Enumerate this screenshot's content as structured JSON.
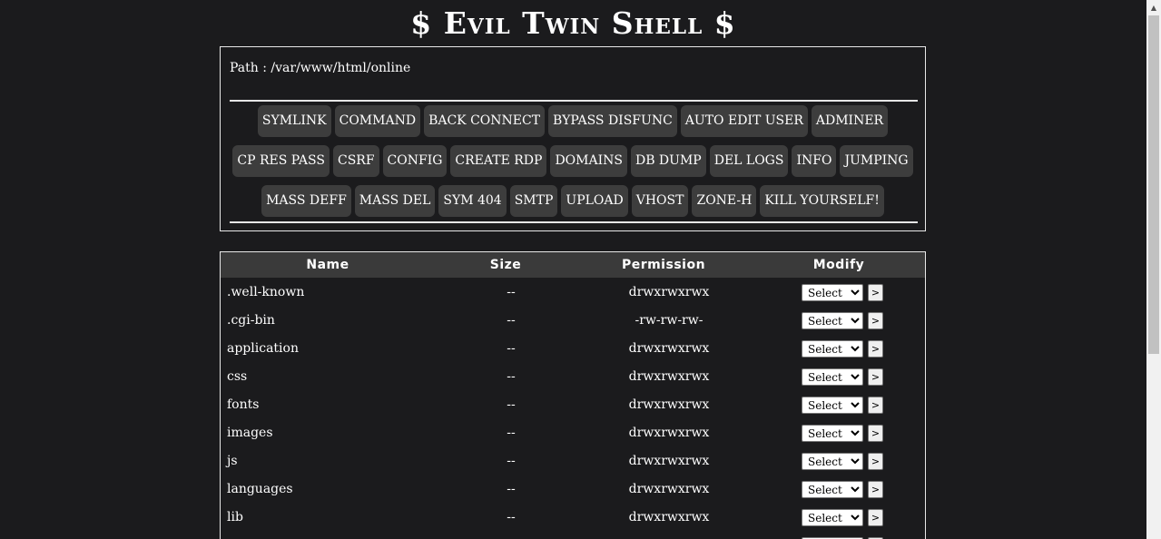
{
  "site": {
    "title": "$ Evil Twin Shell $"
  },
  "path": {
    "label": "Path :",
    "segments": [
      "/",
      "var",
      "/",
      "www",
      "/",
      "html",
      "/",
      "online"
    ]
  },
  "menu": {
    "rows": [
      [
        "SYMLINK",
        "COMMAND",
        "BACK CONNECT",
        "BYPASS DISFUNC",
        "AUTO EDIT USER",
        "ADMINER"
      ],
      [
        "CP RES PASS",
        "CSRF",
        "CONFIG",
        "CREATE RDP",
        "DOMAINS",
        "DB DUMP",
        "DEL LOGS",
        "INFO",
        "JUMPING"
      ],
      [
        "MASS DEFF",
        "MASS DEL",
        "SYM 404",
        "SMTP",
        "UPLOAD",
        "VHOST",
        "ZONE-H",
        "KILL YOURSELF!"
      ]
    ]
  },
  "table": {
    "headers": [
      "Name",
      "Size",
      "Permission",
      "Modify"
    ],
    "select_placeholder": "Select",
    "go_label": ">",
    "rows": [
      {
        "name": ".well-known",
        "size": "--",
        "perm": "drwxrwxrwx"
      },
      {
        "name": ".cgi-bin",
        "size": "--",
        "perm": "-rw-rw-rw-"
      },
      {
        "name": "application",
        "size": "--",
        "perm": "drwxrwxrwx"
      },
      {
        "name": "css",
        "size": "--",
        "perm": "drwxrwxrwx"
      },
      {
        "name": "fonts",
        "size": "--",
        "perm": "drwxrwxrwx"
      },
      {
        "name": "images",
        "size": "--",
        "perm": "drwxrwxrwx"
      },
      {
        "name": "js",
        "size": "--",
        "perm": "drwxrwxrwx"
      },
      {
        "name": "languages",
        "size": "--",
        "perm": "drwxrwxrwx"
      },
      {
        "name": "lib",
        "size": "--",
        "perm": "drwxrwxrwx"
      },
      {
        "name": "",
        "size": "",
        "perm": ""
      }
    ]
  },
  "colors": {
    "background": "#1b1b1d",
    "button": "#3d3d3d",
    "table_header": "#3a3a3a",
    "text": "#ffffff"
  }
}
